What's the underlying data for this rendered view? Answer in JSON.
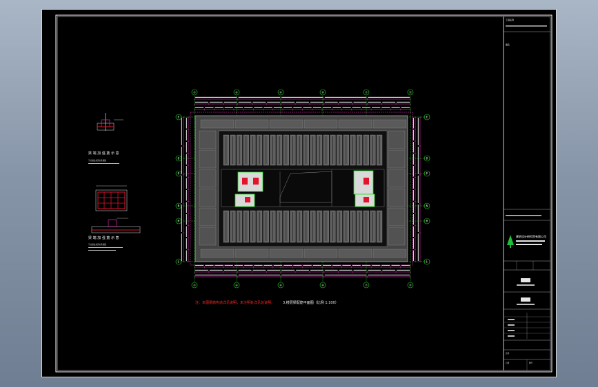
{
  "window": {
    "title": ""
  },
  "colors": {
    "background": "#000000",
    "frame": "#ffffff",
    "grid_axis": "#22dd22",
    "dimension": "#ff33cc",
    "wall": "#5a5a5a",
    "note_red": "#ff2a2a",
    "detail_red": "#e0142b"
  },
  "plan": {
    "top_axes": [
      "②",
      "④",
      "⑥",
      "⑧",
      "⑦",
      "⑪"
    ],
    "bottom_axes": [
      "②",
      "④",
      "⑥",
      "⑧",
      "⑦",
      "⑪"
    ],
    "left_axes": [
      "E",
      "D",
      "P",
      "N",
      "M",
      "L"
    ],
    "right_axes": [
      "E",
      "D",
      "P",
      "N",
      "M",
      "L"
    ],
    "caption": "3.楼层梁配筋平面图（比例 1:100）",
    "note": "注：本图梁筋构造详见说明，未注明处详见总说明。"
  },
  "details": {
    "detail1_title": "梁 端 加 强 筋 示 意",
    "detail1_sub": "节点做法参见标准图集",
    "detail2_title": "梁 端 加 强 筋 示 意",
    "detail2_sub": "节点做法参见标准图集"
  },
  "title_block": {
    "project_label": "工程名称",
    "drawing_label": "图名",
    "company": "建筑设计研究院有限公司",
    "scale_label": "比例",
    "date_label": "日期",
    "sheet_label": "图号"
  },
  "icons": [
    "company-logo-icon"
  ]
}
